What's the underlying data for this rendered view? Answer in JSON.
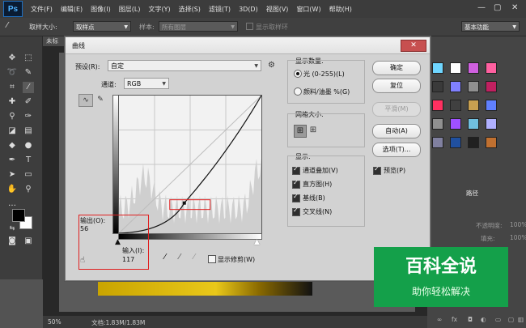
{
  "app": {
    "logo": "Ps"
  },
  "menu": [
    "文件(F)",
    "编辑(E)",
    "图像(I)",
    "图层(L)",
    "文字(Y)",
    "选择(S)",
    "滤镜(T)",
    "3D(D)",
    "视图(V)",
    "窗口(W)",
    "帮助(H)"
  ],
  "window_controls": {
    "minimize": "—",
    "maximize": "▢",
    "close": "✕"
  },
  "options_bar": {
    "sample_size_label": "取样大小:",
    "sample_size_value": "取样点",
    "sample_label": "样本:",
    "sample_value": "所有图层",
    "show_ring_label": "显示取样环",
    "workspace": "基本功能"
  },
  "doc_tab": "未标",
  "status_bar": {
    "zoom": "50%",
    "doc_info": "文档:1.83M/1.83M"
  },
  "dialog": {
    "title": "曲线",
    "close": "✕",
    "preset_label": "预设(R):",
    "preset_value": "自定",
    "channel_label": "通道:",
    "channel_value": "RGB",
    "output_label": "输出(O):",
    "output_value": "56",
    "input_label": "输入(I):",
    "input_value": "117",
    "show_clipping_label": "显示修剪(W)",
    "show_amount_title": "显示数量:",
    "light_label": "光 (0-255)(L)",
    "pigment_label": "颜料/油墨 %(G)",
    "grid_size_title": "网格大小:",
    "display_title": "显示:",
    "display_options": [
      "通道叠加(V)",
      "直方图(H)",
      "基线(B)",
      "交叉线(N)"
    ],
    "buttons": {
      "ok": "确定",
      "reset": "复位",
      "smooth": "平滑(M)",
      "auto": "自动(A)",
      "options": "选项(T)..."
    },
    "preview_label": "预览(P)",
    "curve_point": {
      "input": 117,
      "output": 56
    }
  },
  "right_panel": {
    "tabs": [
      "路径"
    ],
    "opacity_label": "不透明度:",
    "opacity_value": "100%",
    "fill_label": "填充:",
    "fill_value": "100%"
  },
  "watermark": {
    "line1": "百科全说",
    "line2": "助你轻松解决"
  },
  "colors": {
    "accent_green": "#14a04a",
    "selection_red": "#e02020",
    "ps_blue": "#4fb3ff"
  }
}
